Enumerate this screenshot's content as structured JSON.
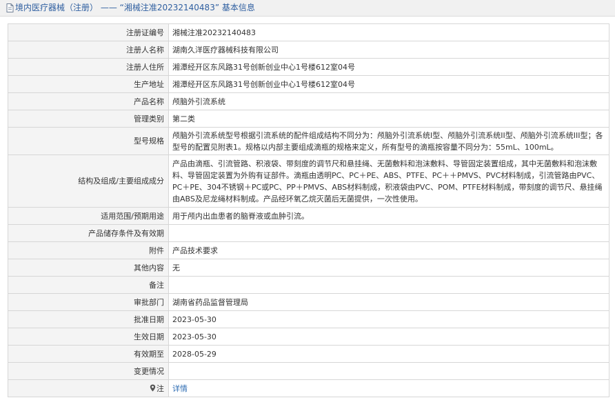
{
  "header": {
    "title": "境内医疗器械（注册） —— “湘械注准20232140483” 基本信息",
    "icon": "document-icon"
  },
  "colors": {
    "title": "#2f5fa0",
    "link": "#2f6db3",
    "label_bg": "#f4f4f4",
    "border": "#d6d6d6"
  },
  "rows": [
    {
      "label": "注册证编号",
      "value": "湘械注准20232140483"
    },
    {
      "label": "注册人名称",
      "value": "湖南久洋医疗器械科技有限公司"
    },
    {
      "label": "注册人住所",
      "value": "湘潭经开区东风路31号创新创业中心1号楼612室04号"
    },
    {
      "label": "生产地址",
      "value": "湘潭经开区东风路31号创新创业中心1号楼612室04号"
    },
    {
      "label": "产品名称",
      "value": "颅脑外引流系统"
    },
    {
      "label": "管理类别",
      "value": "第二类"
    },
    {
      "label": "型号规格",
      "value": "颅脑外引流系统型号根据引流系统的配件组成结构不同分为：颅脑外引流系统I型、颅脑外引流系统II型、颅脑外引流系统III型；各型号的配置见附表1。规格以内部主要组成滴瓶的规格来定义，所有型号的滴瓶按容量不同分为：55mL、100mL。"
    },
    {
      "label": "结构及组成/主要组成成分",
      "value": "产品由滴瓶、引流管路、积液袋、带刻度的调节尺和悬挂绳、无菌敷料和泡沫敷料、导管固定装置组成，其中无菌敷料和泡沫敷料、导管固定装置为外购有证部件。滴瓶由透明PC、PC＋PE、ABS、PTFE、PC＋＋PMVS、PVC材料制成，引流管路由PVC、PC＋PE、304不锈钢＋PC或PC、PP＋PMVS、ABS材料制成，积液袋由PVC、POM、PTFE材料制成，带刻度的调节尺、悬挂绳由ABS及尼龙绳材料制成。产品经环氧乙烷灭菌后无菌提供，一次性使用。"
    },
    {
      "label": "适用范围/预期用途",
      "value": "用于颅内出血患者的脑脊液或血肿引流。"
    },
    {
      "label": "产品储存条件及有效期",
      "value": ""
    },
    {
      "label": "附件",
      "value": "产品技术要求"
    },
    {
      "label": "其他内容",
      "value": "无"
    },
    {
      "label": "备注",
      "value": ""
    },
    {
      "label": "审批部门",
      "value": "湖南省药品监督管理局"
    },
    {
      "label": "批准日期",
      "value": "2023-05-30"
    },
    {
      "label": "生效日期",
      "value": "2023-05-30"
    },
    {
      "label": "有效期至",
      "value": "2028-05-29"
    },
    {
      "label": "变更情况",
      "value": ""
    }
  ],
  "note": {
    "label": "注",
    "icon": "location-pin-icon",
    "link": "详情"
  }
}
